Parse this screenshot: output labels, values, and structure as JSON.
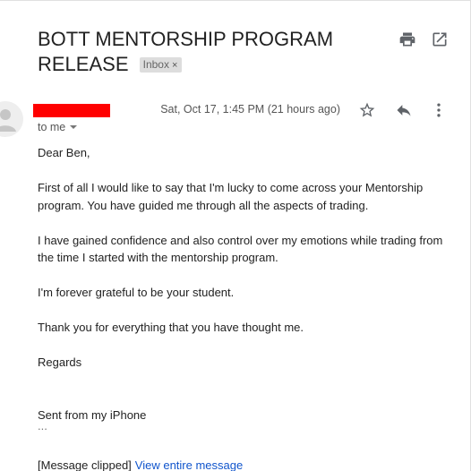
{
  "email": {
    "subject": "BOTT MENTORSHIP PROGRAM RELEASE",
    "label": "Inbox",
    "label_remove": "×",
    "recipient": "to me",
    "date": "Sat, Oct 17, 1:45 PM (21 hours ago)",
    "body": {
      "greeting": "Dear Ben,",
      "p1": "First of all I would like to say that I'm lucky to come across your Mentorship program. You have guided me through all the aspects of trading.",
      "p2": "I have gained confidence and also control over my emotions while trading from the time I started with the mentorship program.",
      "p3": "I'm forever grateful to be your student.",
      "p4": "Thank you for everything that you have thought me.",
      "closing": "Regards",
      "signature": "Sent from my iPhone",
      "trimmed": "..."
    },
    "clipped_text": "[Message clipped]",
    "view_entire_link": "View entire message"
  },
  "icons": {
    "print": "print-icon",
    "new_window": "open-in-new-window-icon",
    "star": "star-icon",
    "reply": "reply-icon",
    "more": "more-vertical-icon",
    "avatar": "default-avatar-icon"
  },
  "colors": {
    "link": "#1155cc",
    "redaction": "#ff0000",
    "badge_bg": "#dddddd",
    "icon_gray": "#5f6368"
  }
}
